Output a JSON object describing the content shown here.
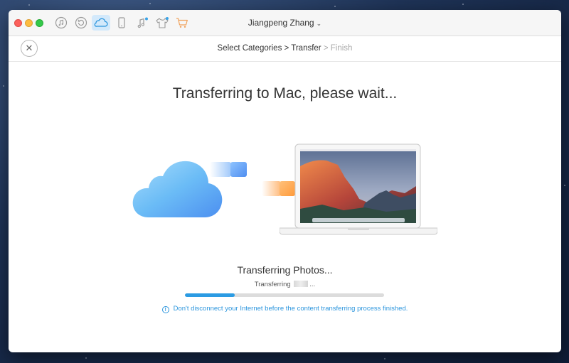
{
  "titlebar": {
    "account_name": "Jiangpeng Zhang",
    "icons": [
      "itunes-icon",
      "restore-icon",
      "icloud-icon",
      "device-icon",
      "ringtone-icon",
      "shirt-icon",
      "cart-icon"
    ],
    "active_icon": "icloud-icon"
  },
  "steps": {
    "step1": "Select Categories",
    "sep1": ">",
    "step2": "Transfer",
    "sep2": ">",
    "step3": "Finish"
  },
  "main": {
    "heading": "Transferring to Mac, please wait..."
  },
  "progress": {
    "title": "Transferring Photos...",
    "sub_prefix": "Transferring",
    "sub_suffix": "...",
    "fraction": 0.25,
    "color": "#2b9be3"
  },
  "notice": {
    "icon_glyph": "!",
    "text": "Don't disconnect your Internet before the content transferring process finished."
  }
}
